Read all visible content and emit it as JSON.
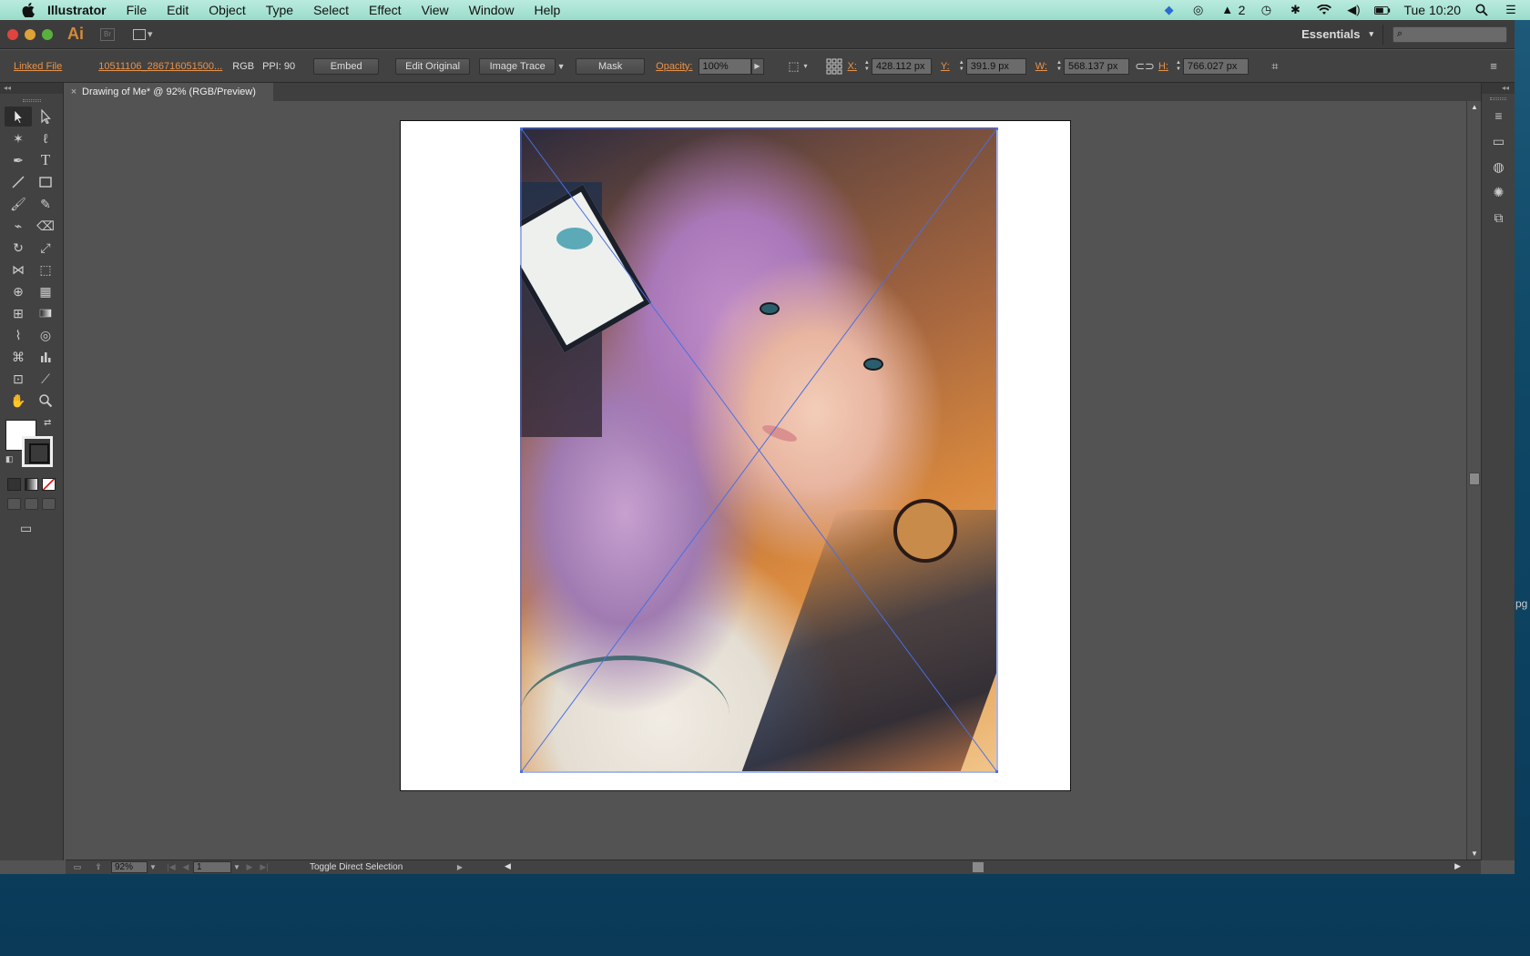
{
  "menubar": {
    "app_name": "Illustrator",
    "items": [
      "File",
      "Edit",
      "Object",
      "Type",
      "Select",
      "Effect",
      "View",
      "Window",
      "Help"
    ],
    "adobe_count": "2",
    "clock": "Tue 10:20"
  },
  "titlebar": {
    "logo": "Ai",
    "bridge": "Br",
    "workspace": "Essentials"
  },
  "controlbar": {
    "linked_file": "Linked File",
    "file_name": "10511106_286716051500...",
    "color_mode": "RGB",
    "ppi": "PPI: 90",
    "embed": "Embed",
    "edit_original": "Edit Original",
    "image_trace": "Image Trace",
    "mask": "Mask",
    "opacity_label": "Opacity:",
    "opacity_value": "100%",
    "x_label": "X:",
    "x_value": "428.112 px",
    "y_label": "Y:",
    "y_value": "391.9 px",
    "w_label": "W:",
    "w_value": "568.137 px",
    "h_label": "H:",
    "h_value": "766.027 px"
  },
  "document_tab": {
    "close": "×",
    "title": "Drawing of Me* @ 92% (RGB/Preview)"
  },
  "statusbar": {
    "zoom": "92%",
    "artboard": "1",
    "status_text": "Toggle Direct Selection"
  },
  "external": {
    "partial_text": "pg"
  },
  "colors": {
    "accent_orange": "#e8924a",
    "selection_blue": "#4a6fe0",
    "ui_dark": "#424242",
    "canvas_grey": "#535353"
  }
}
